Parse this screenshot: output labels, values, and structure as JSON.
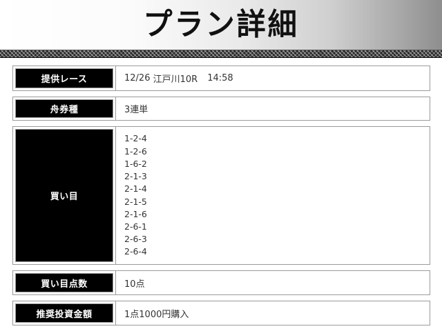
{
  "page": {
    "title": "プラン詳細"
  },
  "details": {
    "race": {
      "label": "提供レース",
      "date": "12/26",
      "venue_race": "江戸川10R",
      "time": "14:58"
    },
    "bet_type": {
      "label": "舟券種",
      "value": "3連単"
    },
    "combinations": {
      "label": "買い目",
      "items": [
        "1-2-4",
        "1-2-6",
        "1-6-2",
        "2-1-3",
        "2-1-4",
        "2-1-5",
        "2-1-6",
        "2-6-1",
        "2-6-3",
        "2-6-4"
      ]
    },
    "points": {
      "label": "買い目点数",
      "value": "10点"
    },
    "amount": {
      "label": "推奨投資金額",
      "value": "1点1000円購入"
    }
  },
  "colors": {
    "label_bg": "#000000",
    "label_text": "#ffffff",
    "value_text": "#333333",
    "border": "#9a9a9a"
  }
}
